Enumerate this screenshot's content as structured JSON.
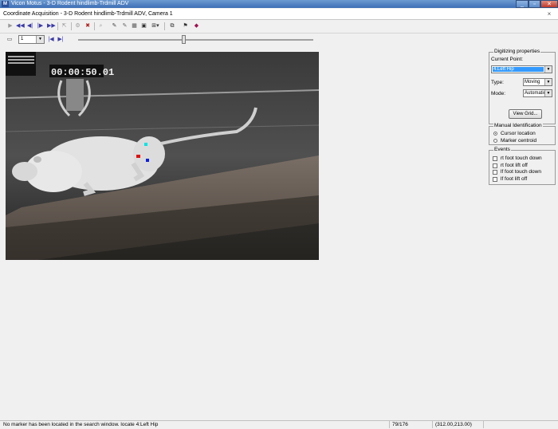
{
  "window": {
    "title": "Vicon Motus - 3-D Rodent hindlimb-Trdmill ADV",
    "app_icon": "M",
    "minimize_glyph": "_",
    "maximize_glyph": "▫",
    "close_glyph": "✕"
  },
  "document": {
    "caption": "Coordinate Acquisition - 3-D Rodent hindlimb-Trdmill ADV, Camera 1",
    "close_glyph": "×"
  },
  "toolbar": {
    "icons": [
      "play-icon",
      "rewind-icon",
      "step-back-icon",
      "step-forward-icon",
      "fast-forward-icon",
      "first-frame-icon",
      "auto-track-icon",
      "clear-marker-icon",
      "magnifier-icon",
      "pen-icon",
      "multi-pen-icon",
      "grid-tool-icon",
      "camera-icon",
      "layout-icon",
      "properties-icon",
      "flag-icon",
      "book-icon"
    ]
  },
  "frame_nav": {
    "frame_value": "1"
  },
  "video": {
    "timestamp": "00:00:50.01"
  },
  "digitizing": {
    "group_title": "Digitizing properties",
    "current_point_label": "Current Point:",
    "current_point_value": "4.Left Hip",
    "type_label": "Type:",
    "type_value": "Moving",
    "mode_label": "Mode:",
    "mode_value": "Automatic",
    "view_grid_label": "View Grid..."
  },
  "manual_identification": {
    "group_title": "Manual Identification",
    "options": [
      {
        "label": "Cursor location",
        "selected": true
      },
      {
        "label": "Marker centroid",
        "selected": false
      }
    ]
  },
  "events": {
    "group_title": "Events",
    "items": [
      {
        "label": "rt foot touch down",
        "checked": false
      },
      {
        "label": "rt foot lift off",
        "checked": false
      },
      {
        "label": "lf foot touch down",
        "checked": false
      },
      {
        "label": "lf foot lift off",
        "checked": false
      }
    ]
  },
  "status": {
    "message": "No marker has been located in the search window. locate 4:Left Hip",
    "frame": "79/176",
    "coords": "(312.00,213.00)"
  },
  "colors": {
    "title_bar": "#3d6eb5",
    "selection": "#3399ff",
    "marker_cyan": "#00e5e5",
    "marker_red": "#e01010",
    "marker_blue": "#1020e0"
  }
}
